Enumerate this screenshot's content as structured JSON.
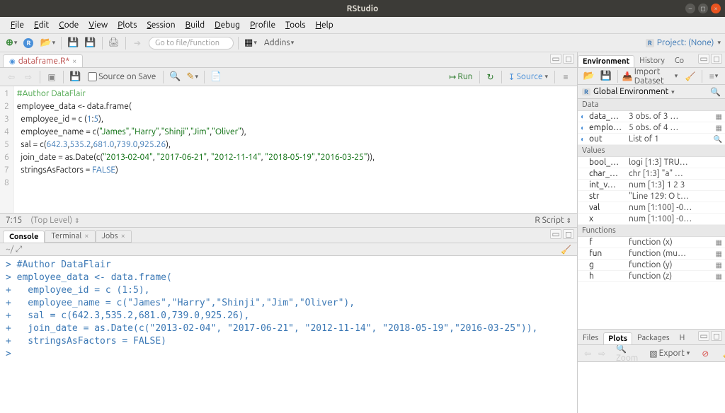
{
  "window": {
    "title": "RStudio"
  },
  "menu": [
    "File",
    "Edit",
    "Code",
    "View",
    "Plots",
    "Session",
    "Build",
    "Debug",
    "Profile",
    "Tools",
    "Help"
  ],
  "toolbar": {
    "goto_placeholder": "Go to file/function",
    "addins_label": "Addins",
    "project_label": "Project: (None)"
  },
  "source": {
    "tab_name": "dataframe.R*",
    "source_on_save": "Source on Save",
    "run_label": "Run",
    "source_label": "Source",
    "status_left": "7:15",
    "status_mid": "(Top Level)",
    "status_right": "R Script",
    "code": [
      {
        "n": 1,
        "tokens": [
          {
            "t": "#Author DataFlair",
            "c": "c-comment"
          }
        ]
      },
      {
        "n": 2,
        "tokens": [
          {
            "t": "employee_data ",
            "c": "c-ident"
          },
          {
            "t": "<- ",
            "c": "c-op"
          },
          {
            "t": "data.frame",
            "c": "c-ident"
          },
          {
            "t": "(",
            "c": "c-op"
          }
        ]
      },
      {
        "n": 3,
        "tokens": [
          {
            "t": "  employee_id ",
            "c": "c-ident"
          },
          {
            "t": "= ",
            "c": "c-op"
          },
          {
            "t": "c ",
            "c": "c-ident"
          },
          {
            "t": "(",
            "c": "c-op"
          },
          {
            "t": "1",
            "c": "c-num"
          },
          {
            "t": ":",
            "c": "c-op"
          },
          {
            "t": "5",
            "c": "c-num"
          },
          {
            "t": "),",
            "c": "c-op"
          }
        ]
      },
      {
        "n": 4,
        "tokens": [
          {
            "t": "  employee_name ",
            "c": "c-ident"
          },
          {
            "t": "= ",
            "c": "c-op"
          },
          {
            "t": "c",
            "c": "c-ident"
          },
          {
            "t": "(",
            "c": "c-op"
          },
          {
            "t": "\"James\"",
            "c": "c-str"
          },
          {
            "t": ",",
            "c": "c-op"
          },
          {
            "t": "\"Harry\"",
            "c": "c-str"
          },
          {
            "t": ",",
            "c": "c-op"
          },
          {
            "t": "\"Shinji\"",
            "c": "c-str"
          },
          {
            "t": ",",
            "c": "c-op"
          },
          {
            "t": "\"Jim\"",
            "c": "c-str"
          },
          {
            "t": ",",
            "c": "c-op"
          },
          {
            "t": "\"Oliver\"",
            "c": "c-str"
          },
          {
            "t": "),",
            "c": "c-op"
          }
        ]
      },
      {
        "n": 5,
        "tokens": [
          {
            "t": "  sal ",
            "c": "c-ident"
          },
          {
            "t": "= ",
            "c": "c-op"
          },
          {
            "t": "c",
            "c": "c-ident"
          },
          {
            "t": "(",
            "c": "c-op"
          },
          {
            "t": "642.3",
            "c": "c-num"
          },
          {
            "t": ",",
            "c": "c-op"
          },
          {
            "t": "535.2",
            "c": "c-num"
          },
          {
            "t": ",",
            "c": "c-op"
          },
          {
            "t": "681.0",
            "c": "c-num"
          },
          {
            "t": ",",
            "c": "c-op"
          },
          {
            "t": "739.0",
            "c": "c-num"
          },
          {
            "t": ",",
            "c": "c-op"
          },
          {
            "t": "925.26",
            "c": "c-num"
          },
          {
            "t": "),",
            "c": "c-op"
          }
        ]
      },
      {
        "n": 6,
        "tokens": [
          {
            "t": "  join_date ",
            "c": "c-ident"
          },
          {
            "t": "= ",
            "c": "c-op"
          },
          {
            "t": "as.Date",
            "c": "c-ident"
          },
          {
            "t": "(",
            "c": "c-op"
          },
          {
            "t": "c",
            "c": "c-ident"
          },
          {
            "t": "(",
            "c": "c-op"
          },
          {
            "t": "\"2013-02-04\"",
            "c": "c-str"
          },
          {
            "t": ", ",
            "c": "c-op"
          },
          {
            "t": "\"2017-06-21\"",
            "c": "c-str"
          },
          {
            "t": ", ",
            "c": "c-op"
          },
          {
            "t": "\"2012-11-14\"",
            "c": "c-str"
          },
          {
            "t": ", ",
            "c": "c-op"
          },
          {
            "t": "\"2018-05-19\"",
            "c": "c-str"
          },
          {
            "t": ",",
            "c": "c-op"
          },
          {
            "t": "\"2016-03-25\"",
            "c": "c-str"
          },
          {
            "t": ")),",
            "c": "c-op"
          }
        ]
      },
      {
        "n": 7,
        "tokens": [
          {
            "t": "  stringsAsFactors ",
            "c": "c-ident"
          },
          {
            "t": "= ",
            "c": "c-op"
          },
          {
            "t": "FALSE",
            "c": "c-kw"
          },
          {
            "t": ")",
            "c": "c-op"
          }
        ]
      },
      {
        "n": 8,
        "tokens": []
      }
    ]
  },
  "console": {
    "tabs": [
      "Console",
      "Terminal",
      "Jobs"
    ],
    "cwd": "~/",
    "lines": [
      "> #Author DataFlair",
      "> employee_data <- data.frame(",
      "+   employee_id = c (1:5),",
      "+   employee_name = c(\"James\",\"Harry\",\"Shinji\",\"Jim\",\"Oliver\"),",
      "+   sal = c(642.3,535.2,681.0,739.0,925.26),",
      "+   join_date = as.Date(c(\"2013-02-04\", \"2017-06-21\", \"2012-11-14\", \"2018-05-19\",\"2016-03-25\")),",
      "+   stringsAsFactors = FALSE)",
      "> "
    ]
  },
  "env": {
    "tabs": [
      "Environment",
      "History",
      "Connections"
    ],
    "tabs_short": [
      "Environment",
      "History",
      "Co"
    ],
    "import_label": "Import Dataset",
    "scope_label": "Global Environment",
    "sections": [
      {
        "title": "Data",
        "rows": [
          {
            "exp": true,
            "name": "data_…",
            "val": "3 obs. of 3 …",
            "grid": true
          },
          {
            "exp": true,
            "name": "emplo…",
            "val": "5 obs. of 4 …",
            "grid": true
          },
          {
            "exp": true,
            "name": "out",
            "val": "List of 1",
            "grid": false,
            "search": true
          }
        ]
      },
      {
        "title": "Values",
        "rows": [
          {
            "name": "bool_…",
            "val": "logi [1:3] TRU…"
          },
          {
            "name": "char_…",
            "val": "chr [1:3] \"a\" …"
          },
          {
            "name": "int_v…",
            "val": "num [1:3] 1 2 3"
          },
          {
            "name": "str",
            "val": "\"Line 129: O t…"
          },
          {
            "name": "val",
            "val": "num [1:100] -0…"
          },
          {
            "name": "x",
            "val": "num [1:100] -0…"
          }
        ]
      },
      {
        "title": "Functions",
        "rows": [
          {
            "name": "f",
            "val": "function (x)",
            "grid": true
          },
          {
            "name": "fun",
            "val": "function (mu…",
            "grid": true
          },
          {
            "name": "g",
            "val": "function (y)",
            "grid": true
          },
          {
            "name": "h",
            "val": "function (z)",
            "grid": true
          }
        ]
      }
    ]
  },
  "files": {
    "tabs": [
      "Files",
      "Plots",
      "Packages",
      "Help"
    ],
    "tabs_short": [
      "Files",
      "Plots",
      "Packages",
      "H"
    ],
    "zoom_label": "Zoom",
    "export_label": "Export"
  }
}
